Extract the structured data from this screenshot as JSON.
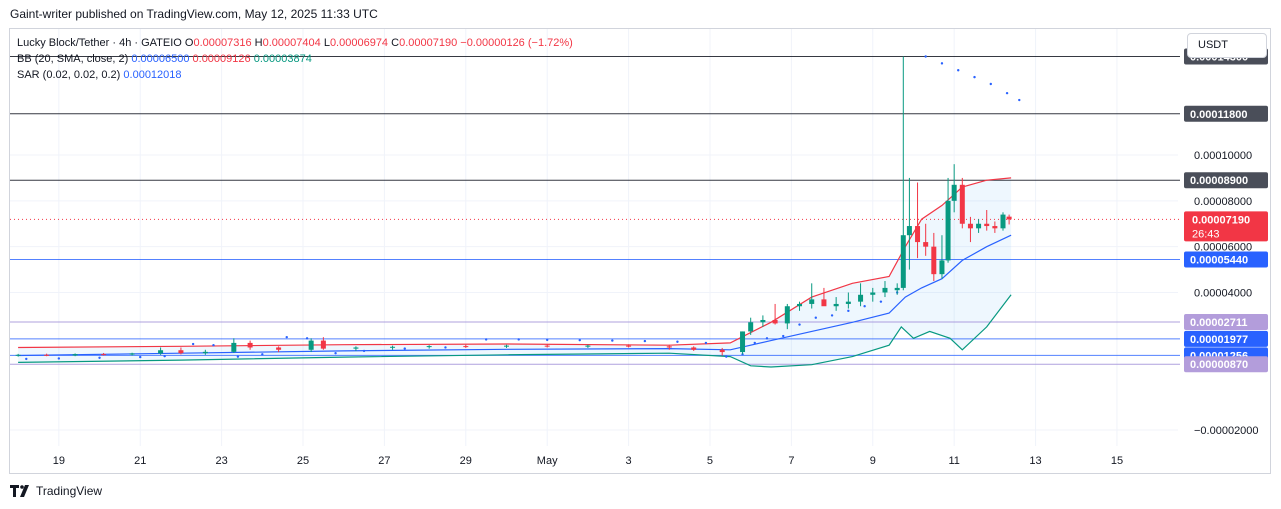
{
  "header": {
    "published": "Gaint-writer published on TradingView.com, May 12, 2025 11:33 UTC"
  },
  "legend": {
    "symbol": "Lucky Block/Tether · 4h · GATEIO",
    "o_label": "O",
    "o": "0.00007316",
    "h_label": "H",
    "h": "0.00007404",
    "l_label": "L",
    "l": "0.00006974",
    "c_label": "C",
    "c": "0.00007190",
    "change": "−0.00000126 (−1.72%)",
    "bb_label": "BB (20, SMA, close, 2)",
    "bb_basis": "0.00006500",
    "bb_upper": "0.00009126",
    "bb_lower": "0.00003874",
    "sar_label": "SAR (0.02, 0.02, 0.2)",
    "sar": "0.00012018"
  },
  "currency": "USDT",
  "countdown": "26:43",
  "brand": "TradingView",
  "colors": {
    "up": "#089981",
    "down": "#f23645",
    "bb_upper": "#f23645",
    "bb_basis": "#2962ff",
    "bb_lower": "#089981",
    "sar": "#2962ff"
  },
  "chart_data": {
    "type": "candlestick",
    "y_ticks": [
      {
        "value": 0.0001,
        "label": "0.00010000"
      },
      {
        "value": 8e-05,
        "label": "0.00008000"
      },
      {
        "value": 6e-05,
        "label": "0.00006000"
      },
      {
        "value": 4e-05,
        "label": "0.00004000"
      },
      {
        "value": -2e-05,
        "label": "−0.00002000"
      }
    ],
    "ylim": [
      -2.7e-05,
      0.000155
    ],
    "x_ticks": [
      {
        "day": 19,
        "label": "19"
      },
      {
        "day": 21,
        "label": "21"
      },
      {
        "day": 23,
        "label": "23"
      },
      {
        "day": 25,
        "label": "25"
      },
      {
        "day": 27,
        "label": "27"
      },
      {
        "day": 29,
        "label": "29"
      },
      {
        "day": 31,
        "label": "May"
      },
      {
        "day": 33,
        "label": "3"
      },
      {
        "day": 35,
        "label": "5"
      },
      {
        "day": 37,
        "label": "7"
      },
      {
        "day": 39,
        "label": "9"
      },
      {
        "day": 41,
        "label": "11"
      },
      {
        "day": 43,
        "label": "13"
      },
      {
        "day": 45,
        "label": "15"
      }
    ],
    "xlim": [
      17.8,
      46.5
    ],
    "horizontal_levels": [
      {
        "value": 0.000143,
        "label": "0.00014300",
        "color": "#131722",
        "bg": "#4a4e59"
      },
      {
        "value": 0.000118,
        "label": "0.00011800",
        "color": "#131722",
        "bg": "#4a4e59"
      },
      {
        "value": 8.9e-05,
        "label": "0.00008900",
        "color": "#131722",
        "bg": "#4a4e59"
      },
      {
        "value": 5.44e-05,
        "label": "0.00005440",
        "color": "#2962ff",
        "bg": "#2962ff"
      },
      {
        "value": 2.711e-05,
        "label": "0.00002711",
        "color": "#9c89d6",
        "bg": "#b39ddb"
      },
      {
        "value": 1.977e-05,
        "label": "0.00001977",
        "color": "#2962ff",
        "bg": "#2962ff"
      },
      {
        "value": 1.256e-05,
        "label": "0.00001256",
        "color": "#2962ff",
        "bg": "#2962ff"
      },
      {
        "value": 8.7e-06,
        "label": "0.00000870",
        "color": "#9c89d6",
        "bg": "#b39ddb"
      }
    ],
    "last_price": {
      "value": 7.19e-05,
      "label": "0.00007190"
    },
    "candles": [
      {
        "d": 18.0,
        "o": 1.26e-05,
        "h": 1.32e-05,
        "l": 1.2e-05,
        "c": 1.28e-05
      },
      {
        "d": 18.7,
        "o": 1.28e-05,
        "h": 1.33e-05,
        "l": 1.22e-05,
        "c": 1.25e-05
      },
      {
        "d": 19.4,
        "o": 1.25e-05,
        "h": 1.34e-05,
        "l": 1.22e-05,
        "c": 1.31e-05
      },
      {
        "d": 20.1,
        "o": 1.31e-05,
        "h": 1.36e-05,
        "l": 1.25e-05,
        "c": 1.29e-05
      },
      {
        "d": 20.8,
        "o": 1.29e-05,
        "h": 1.37e-05,
        "l": 1.25e-05,
        "c": 1.34e-05
      },
      {
        "d": 21.5,
        "o": 1.34e-05,
        "h": 1.6e-05,
        "l": 1.28e-05,
        "c": 1.48e-05
      },
      {
        "d": 22.0,
        "o": 1.48e-05,
        "h": 1.6e-05,
        "l": 1.3e-05,
        "c": 1.35e-05
      },
      {
        "d": 22.6,
        "o": 1.35e-05,
        "h": 1.5e-05,
        "l": 1.28e-05,
        "c": 1.41e-05
      },
      {
        "d": 23.3,
        "o": 1.41e-05,
        "h": 2e-05,
        "l": 1.36e-05,
        "c": 1.8e-05
      },
      {
        "d": 23.7,
        "o": 1.8e-05,
        "h": 1.9e-05,
        "l": 1.5e-05,
        "c": 1.6e-05
      },
      {
        "d": 24.4,
        "o": 1.6e-05,
        "h": 1.65e-05,
        "l": 1.4e-05,
        "c": 1.5e-05
      },
      {
        "d": 25.2,
        "o": 1.5e-05,
        "h": 2e-05,
        "l": 1.4e-05,
        "c": 1.9e-05
      },
      {
        "d": 25.5,
        "o": 1.9e-05,
        "h": 2.05e-05,
        "l": 1.5e-05,
        "c": 1.55e-05
      },
      {
        "d": 26.3,
        "o": 1.55e-05,
        "h": 1.65e-05,
        "l": 1.45e-05,
        "c": 1.6e-05
      },
      {
        "d": 27.2,
        "o": 1.6e-05,
        "h": 1.68e-05,
        "l": 1.5e-05,
        "c": 1.63e-05
      },
      {
        "d": 28.1,
        "o": 1.63e-05,
        "h": 1.7e-05,
        "l": 1.55e-05,
        "c": 1.66e-05
      },
      {
        "d": 29.0,
        "o": 1.66e-05,
        "h": 1.72e-05,
        "l": 1.58e-05,
        "c": 1.64e-05
      },
      {
        "d": 30.0,
        "o": 1.64e-05,
        "h": 1.72e-05,
        "l": 1.58e-05,
        "c": 1.68e-05
      },
      {
        "d": 31.0,
        "o": 1.68e-05,
        "h": 1.75e-05,
        "l": 1.6e-05,
        "c": 1.66e-05
      },
      {
        "d": 32.0,
        "o": 1.66e-05,
        "h": 1.72e-05,
        "l": 1.58e-05,
        "c": 1.68e-05
      },
      {
        "d": 33.0,
        "o": 1.68e-05,
        "h": 1.74e-05,
        "l": 1.6e-05,
        "c": 1.65e-05
      },
      {
        "d": 34.0,
        "o": 1.65e-05,
        "h": 1.72e-05,
        "l": 1.5e-05,
        "c": 1.6e-05
      },
      {
        "d": 34.6,
        "o": 1.6e-05,
        "h": 1.65e-05,
        "l": 1.45e-05,
        "c": 1.5e-05
      },
      {
        "d": 35.3,
        "o": 1.5e-05,
        "h": 1.58e-05,
        "l": 1.25e-05,
        "c": 1.4e-05
      },
      {
        "d": 35.8,
        "o": 1.4e-05,
        "h": 2.3e-05,
        "l": 1.3e-05,
        "c": 2.3e-05
      },
      {
        "d": 36.0,
        "o": 2.3e-05,
        "h": 2.9e-05,
        "l": 2.15e-05,
        "c": 2.7e-05
      },
      {
        "d": 36.3,
        "o": 2.7e-05,
        "h": 3e-05,
        "l": 2.5e-05,
        "c": 2.8e-05
      },
      {
        "d": 36.6,
        "o": 2.8e-05,
        "h": 3.5e-05,
        "l": 2.6e-05,
        "c": 2.65e-05
      },
      {
        "d": 36.9,
        "o": 2.65e-05,
        "h": 3.5e-05,
        "l": 2.4e-05,
        "c": 3.4e-05
      },
      {
        "d": 37.2,
        "o": 3.4e-05,
        "h": 3.6e-05,
        "l": 3.2e-05,
        "c": 3.5e-05
      },
      {
        "d": 37.5,
        "o": 3.5e-05,
        "h": 4.4e-05,
        "l": 3.3e-05,
        "c": 3.7e-05
      },
      {
        "d": 37.8,
        "o": 3.7e-05,
        "h": 4.2e-05,
        "l": 3.5e-05,
        "c": 3.4e-05
      },
      {
        "d": 38.1,
        "o": 3.4e-05,
        "h": 3.8e-05,
        "l": 3.2e-05,
        "c": 3.5e-05
      },
      {
        "d": 38.4,
        "o": 3.5e-05,
        "h": 4e-05,
        "l": 3.3e-05,
        "c": 3.6e-05
      },
      {
        "d": 38.7,
        "o": 3.6e-05,
        "h": 4.4e-05,
        "l": 3.4e-05,
        "c": 3.9e-05
      },
      {
        "d": 39.0,
        "o": 3.9e-05,
        "h": 4.2e-05,
        "l": 3.6e-05,
        "c": 4e-05
      },
      {
        "d": 39.3,
        "o": 4e-05,
        "h": 4.5e-05,
        "l": 3.8e-05,
        "c": 4.2e-05
      },
      {
        "d": 39.6,
        "o": 4.1e-05,
        "h": 4.4e-05,
        "l": 3.9e-05,
        "c": 4.2e-05
      },
      {
        "d": 39.75,
        "o": 4.2e-05,
        "h": 0.000143,
        "l": 4.1e-05,
        "c": 6.5e-05
      },
      {
        "d": 39.9,
        "o": 6.5e-05,
        "h": 9e-05,
        "l": 5e-05,
        "c": 6.9e-05
      },
      {
        "d": 40.1,
        "o": 6.9e-05,
        "h": 8.8e-05,
        "l": 5.5e-05,
        "c": 6.2e-05
      },
      {
        "d": 40.3,
        "o": 6.2e-05,
        "h": 7e-05,
        "l": 5.6e-05,
        "c": 6e-05
      },
      {
        "d": 40.5,
        "o": 6e-05,
        "h": 6.6e-05,
        "l": 4.5e-05,
        "c": 4.8e-05
      },
      {
        "d": 40.7,
        "o": 4.8e-05,
        "h": 6.5e-05,
        "l": 4.6e-05,
        "c": 5.4e-05
      },
      {
        "d": 40.85,
        "o": 5.4e-05,
        "h": 9e-05,
        "l": 5.3e-05,
        "c": 8e-05
      },
      {
        "d": 41.0,
        "o": 8e-05,
        "h": 9.6e-05,
        "l": 7.5e-05,
        "c": 8.7e-05
      },
      {
        "d": 41.2,
        "o": 8.7e-05,
        "h": 9e-05,
        "l": 6.8e-05,
        "c": 7e-05
      },
      {
        "d": 41.4,
        "o": 7e-05,
        "h": 7.3e-05,
        "l": 6.2e-05,
        "c": 6.8e-05
      },
      {
        "d": 41.6,
        "o": 6.8e-05,
        "h": 7.2e-05,
        "l": 6.6e-05,
        "c": 7e-05
      },
      {
        "d": 41.8,
        "o": 7e-05,
        "h": 7.6e-05,
        "l": 6.7e-05,
        "c": 6.9e-05
      },
      {
        "d": 42.0,
        "o": 6.9e-05,
        "h": 7.1e-05,
        "l": 6.6e-05,
        "c": 6.8e-05
      },
      {
        "d": 42.2,
        "o": 6.8e-05,
        "h": 7.5e-05,
        "l": 6.7e-05,
        "c": 7.4e-05
      },
      {
        "d": 42.35,
        "o": 7.31e-05,
        "h": 7.4e-05,
        "l": 6.97e-05,
        "c": 7.19e-05
      }
    ],
    "bb_upper": [
      [
        18,
        1.6e-05
      ],
      [
        22,
        1.65e-05
      ],
      [
        26,
        1.72e-05
      ],
      [
        30,
        1.75e-05
      ],
      [
        34,
        1.7e-05
      ],
      [
        35.5,
        1.8e-05
      ],
      [
        36.5,
        2.7e-05
      ],
      [
        37.5,
        3.8e-05
      ],
      [
        38.5,
        4.4e-05
      ],
      [
        39.4,
        4.7e-05
      ],
      [
        39.8,
        6e-05
      ],
      [
        40.2,
        7.2e-05
      ],
      [
        40.7,
        7.8e-05
      ],
      [
        41.2,
        8.6e-05
      ],
      [
        41.8,
        8.9e-05
      ],
      [
        42.4,
        9e-05
      ]
    ],
    "bb_basis": [
      [
        18,
        1.25e-05
      ],
      [
        22,
        1.35e-05
      ],
      [
        26,
        1.45e-05
      ],
      [
        30,
        1.52e-05
      ],
      [
        34,
        1.55e-05
      ],
      [
        35.5,
        1.5e-05
      ],
      [
        36.5,
        1.9e-05
      ],
      [
        37.5,
        2.3e-05
      ],
      [
        38.5,
        2.7e-05
      ],
      [
        39.4,
        3.1e-05
      ],
      [
        39.8,
        3.8e-05
      ],
      [
        40.2,
        4.2e-05
      ],
      [
        40.7,
        4.6e-05
      ],
      [
        41.2,
        5.4e-05
      ],
      [
        41.8,
        6e-05
      ],
      [
        42.4,
        6.5e-05
      ]
    ],
    "bb_lower": [
      [
        18,
        9.5e-06
      ],
      [
        22,
        1.05e-05
      ],
      [
        26,
        1.18e-05
      ],
      [
        30,
        1.28e-05
      ],
      [
        34,
        1.35e-05
      ],
      [
        35.5,
        1.2e-05
      ],
      [
        36.0,
        8e-06
      ],
      [
        36.5,
        7.5e-06
      ],
      [
        37.5,
        8.5e-06
      ],
      [
        38.5,
        1.2e-05
      ],
      [
        39.4,
        1.7e-05
      ],
      [
        39.7,
        2.5e-05
      ],
      [
        40.0,
        2e-05
      ],
      [
        40.4,
        2.3e-05
      ],
      [
        40.9,
        2e-05
      ],
      [
        41.2,
        1.5e-05
      ],
      [
        41.8,
        2.5e-05
      ],
      [
        42.4,
        3.9e-05
      ]
    ],
    "sar": [
      [
        18.2,
        1.1e-05
      ],
      [
        19.0,
        1.12e-05
      ],
      [
        20.0,
        1.15e-05
      ],
      [
        21.0,
        1.18e-05
      ],
      [
        21.6,
        1.22e-05
      ],
      [
        22.3,
        1.75e-05
      ],
      [
        22.8,
        1.7e-05
      ],
      [
        23.4,
        1.2e-05
      ],
      [
        24.0,
        1.3e-05
      ],
      [
        24.6,
        2.05e-05
      ],
      [
        25.1,
        2e-05
      ],
      [
        25.8,
        1.35e-05
      ],
      [
        26.5,
        1.45e-05
      ],
      [
        27.5,
        1.55e-05
      ],
      [
        28.5,
        1.6e-05
      ],
      [
        29.5,
        1.95e-05
      ],
      [
        30.3,
        1.95e-05
      ],
      [
        31.0,
        1.93e-05
      ],
      [
        31.8,
        1.92e-05
      ],
      [
        32.6,
        1.9e-05
      ],
      [
        33.4,
        1.88e-05
      ],
      [
        34.2,
        1.85e-05
      ],
      [
        34.9,
        1.8e-05
      ],
      [
        35.4,
        1.2e-05
      ],
      [
        35.8,
        1.3e-05
      ],
      [
        36.1,
        1.8e-05
      ],
      [
        36.4,
        2e-05
      ],
      [
        36.8,
        2.1e-05
      ],
      [
        37.2,
        2.6e-05
      ],
      [
        37.6,
        2.9e-05
      ],
      [
        38.0,
        3e-05
      ],
      [
        38.4,
        3.2e-05
      ],
      [
        38.8,
        3.4e-05
      ],
      [
        39.2,
        3.6e-05
      ],
      [
        39.6,
        4e-05
      ],
      [
        40.3,
        0.000143
      ],
      [
        40.7,
        0.00014
      ],
      [
        41.1,
        0.000137
      ],
      [
        41.5,
        0.000134
      ],
      [
        41.9,
        0.000131
      ],
      [
        42.3,
        0.000127
      ],
      [
        42.6,
        0.000124
      ]
    ]
  }
}
